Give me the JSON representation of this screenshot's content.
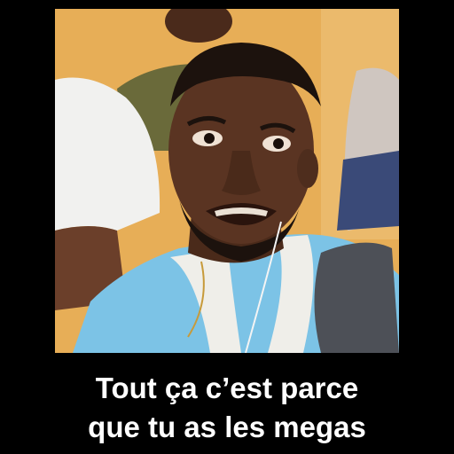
{
  "caption": {
    "line1": "Tout ça c’est parce",
    "line2": "que tu as les megas"
  },
  "colors": {
    "background": "#000000",
    "caption_text": "#ffffff",
    "wall": "#e9b25a",
    "shirt_blue": "#7cc3e6",
    "skin": "#5a3422"
  }
}
